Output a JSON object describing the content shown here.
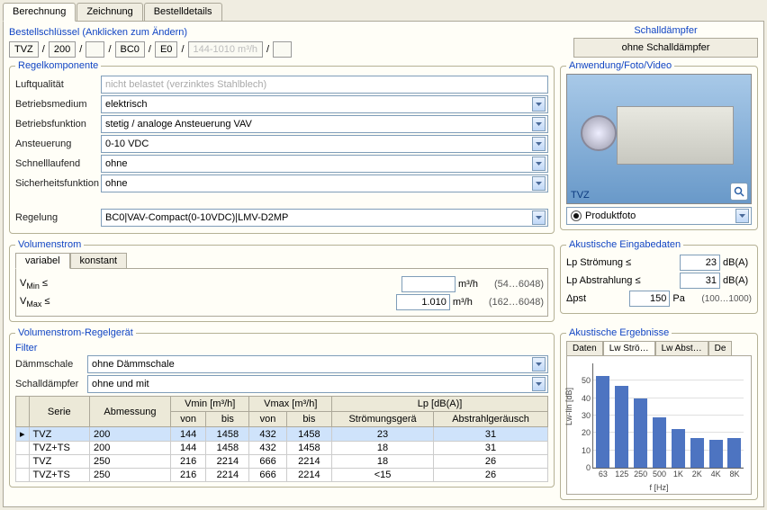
{
  "tabs": {
    "t0": "Berechnung",
    "t1": "Zeichnung",
    "t2": "Bestelldetails"
  },
  "orderkey": {
    "label": "Bestellschlüssel (Anklicken zum Ändern)",
    "items": [
      "TVZ",
      "200",
      "",
      "BC0",
      "E0",
      "144-1010 m³/h",
      ""
    ]
  },
  "schalldaempfer": {
    "title": "Schalldämpfer",
    "button": "ohne Schalldämpfer"
  },
  "regel": {
    "legend": "Regelkomponente",
    "rows": {
      "luftqual_l": "Luftqualität",
      "luftqual_v": "nicht belastet (verzinktes Stahlblech)",
      "medium_l": "Betriebsmedium",
      "medium_v": "elektrisch",
      "funk_l": "Betriebsfunktion",
      "funk_v": "stetig / analoge Ansteuerung VAV",
      "anst_l": "Ansteuerung",
      "anst_v": "0-10 VDC",
      "schnell_l": "Schnelllaufend",
      "schnell_v": "ohne",
      "sicher_l": "Sicherheitsfunktion",
      "sicher_v": "ohne",
      "regelung_l": "Regelung",
      "regelung_v": "BC0|VAV-Compact(0-10VDC)|LMV-D2MP"
    }
  },
  "anwendung": {
    "legend": "Anwendung/Foto/Video",
    "imglabel": "TVZ",
    "option": "Produktfoto"
  },
  "volstrom": {
    "legend": "Volumenstrom",
    "tabs": {
      "t0": "variabel",
      "t1": "konstant"
    },
    "vmin_l": "V",
    "vmin_sub": "Min",
    "vmin_sign": " ≤",
    "vmax_l": "V",
    "vmax_sub": "Max",
    "vmax_sign": " ≤",
    "vmin_val": "",
    "vmax_val": "1.010",
    "unit": "m³/h",
    "vmin_range": "(54…6048)",
    "vmax_range": "(162…6048)"
  },
  "ak_in": {
    "legend": "Akustische Eingabedaten",
    "r1_l": "Lp Strömung ≤",
    "r1_v": "23",
    "r1_u": "dB(A)",
    "r2_l": "Lp Abstrahlung ≤",
    "r2_v": "31",
    "r2_u": "dB(A)",
    "r3_l": "Δpst",
    "r3_v": "150",
    "r3_u": "Pa",
    "r3_range": "(100…1000)"
  },
  "geraet": {
    "legend": "Volumenstrom-Regelgerät",
    "filter": "Filter",
    "damm_l": "Dämmschale",
    "damm_v": "ohne Dämmschale",
    "sd_l": "Schalldämpfer",
    "sd_v": "ohne und mit",
    "headers": {
      "serie": "Serie",
      "abm": "Abmessung",
      "vmin": "Vmin [m³/h]",
      "vmax": "Vmax [m³/h]",
      "lp": "Lp [dB(A)]",
      "von": "von",
      "bis": "bis",
      "strom": "Strömungsgerä",
      "abstr": "Abstrahlgeräusch"
    },
    "rows": [
      {
        "s": "TVZ",
        "a": "200",
        "vmi": "144",
        "vma": "1458",
        "xmi": "432",
        "xma": "1458",
        "st": "23",
        "ab": "31"
      },
      {
        "s": "TVZ+TS",
        "a": "200",
        "vmi": "144",
        "vma": "1458",
        "xmi": "432",
        "xma": "1458",
        "st": "18",
        "ab": "31"
      },
      {
        "s": "TVZ",
        "a": "250",
        "vmi": "216",
        "vma": "2214",
        "xmi": "666",
        "xma": "2214",
        "st": "18",
        "ab": "26"
      },
      {
        "s": "TVZ+TS",
        "a": "250",
        "vmi": "216",
        "vma": "2214",
        "xmi": "666",
        "xma": "2214",
        "st": "<15",
        "ab": "26"
      }
    ]
  },
  "ak_erg": {
    "legend": "Akustische Ergebnisse",
    "tabs": {
      "t0": "Daten",
      "t1": "Lw Strö…",
      "t2": "Lw Abst…",
      "t3": "De"
    }
  },
  "chart_data": {
    "type": "bar",
    "categories": [
      "63",
      "125",
      "250",
      "500",
      "1K",
      "2K",
      "4K",
      "8K"
    ],
    "values": [
      53,
      47,
      40,
      29,
      22,
      17,
      16,
      17
    ],
    "ylabel": "Lw-lin [dB]",
    "xlabel": "f [Hz]",
    "ylim": [
      0,
      60
    ],
    "yticks": [
      0,
      10,
      20,
      30,
      40,
      50
    ]
  }
}
